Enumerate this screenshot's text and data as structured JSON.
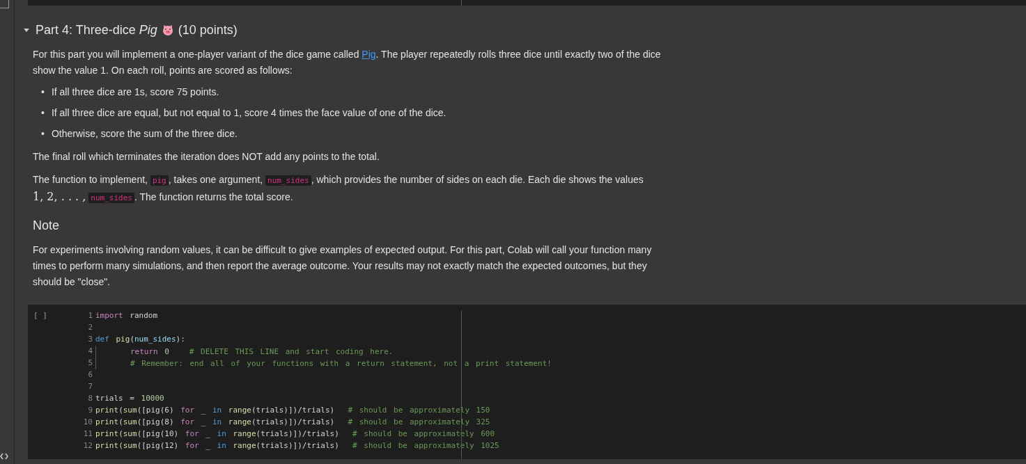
{
  "section": {
    "expanded": true,
    "title": "Part 4: Three-dice *Pig*",
    "points": "(10 points)"
  },
  "intro": [
    {
      "kind": "text",
      "text": "For this part you will implement a one-player variant of the dice game called "
    },
    {
      "kind": "link",
      "text": "Pig"
    },
    {
      "kind": "text",
      "text": ". The player repeatedly rolls three dice until exactly two of the dice show the value 1. On each roll, points are scored as follows:"
    }
  ],
  "rules": [
    {
      "marker": "•",
      "text": "If all three dice are 1s, score 75 points."
    },
    {
      "marker": "•",
      "text": "If all three dice are equal, but not equal to 1, score 4 times the face value of one of the dice."
    },
    {
      "marker": "•",
      "text": "Otherwise, score the sum of the three dice."
    }
  ],
  "final_note": "The final roll which terminates the iteration does NOT add any points to the total.",
  "function_desc": [
    {
      "kind": "text",
      "text": "The function to implement, "
    },
    {
      "kind": "code",
      "text": "pig"
    },
    {
      "kind": "text",
      "text": ", takes one argument, "
    },
    {
      "kind": "code",
      "text": "num_sides"
    },
    {
      "kind": "text",
      "text": ", which provides the number of sides on each die. Each die shows the values "
    },
    {
      "kind": "math",
      "text": "1, 2, . . . ,"
    },
    {
      "kind": "code",
      "text": "num_sides"
    },
    {
      "kind": "text",
      "text": ". The function returns the total score."
    }
  ],
  "note_heading": "Note",
  "note": "For experiments involving random values, it can be difficult to give examples of expected output. For this part, Colab will call your function many times to perform many simulations, and then report the average outcome. Your results may not exactly match the expected outcomes, but they should be \"close\".",
  "code_cell": {
    "run_marker": "[ ]",
    "lines": [
      {
        "number": "1",
        "tokens": [
          {
            "kind": "keyword",
            "text": "import"
          },
          {
            "kind": "plain",
            "text": " random"
          }
        ]
      },
      {
        "number": "2"
      },
      {
        "number": "3",
        "tokens": [
          {
            "kind": "def",
            "text": "def"
          },
          {
            "kind": "func",
            "text": " pig"
          },
          {
            "kind": "plain",
            "text": "("
          },
          {
            "kind": "param",
            "text": "num_sides"
          },
          {
            "kind": "plain",
            "text": "):"
          }
        ]
      },
      {
        "number": "4",
        "tokens": [
          {
            "kind": "indent"
          },
          {
            "kind": "keyword",
            "text": "return"
          },
          {
            "kind": "number",
            "text": " 0"
          },
          {
            "kind": "comment",
            "text": "   # DELETE THIS LINE and start coding here."
          }
        ]
      },
      {
        "number": "5",
        "tokens": [
          {
            "kind": "indent"
          },
          {
            "kind": "comment",
            "text": "# Remember: end all of your functions with a return statement, not a print statement!"
          }
        ]
      },
      {
        "number": "6"
      },
      {
        "number": "7"
      },
      {
        "number": "8",
        "tokens": [
          {
            "kind": "plain",
            "text": "trials = "
          },
          {
            "kind": "number",
            "text": "10000"
          }
        ]
      },
      {
        "number": "9",
        "tokens": [
          {
            "kind": "func",
            "text": "print"
          },
          {
            "kind": "plain",
            "text": "("
          },
          {
            "kind": "func",
            "text": "sum"
          },
          {
            "kind": "plain",
            "text": "([pig(6) "
          },
          {
            "kind": "keyword",
            "text": "for"
          },
          {
            "kind": "plain",
            "text": " _ "
          },
          {
            "kind": "def",
            "text": "in"
          },
          {
            "kind": "func",
            "text": " range"
          },
          {
            "kind": "plain",
            "text": "(trials)])/trials)  "
          },
          {
            "kind": "comment",
            "text": "# should be approximately 150"
          }
        ]
      },
      {
        "number": "10",
        "tokens": [
          {
            "kind": "func",
            "text": "print"
          },
          {
            "kind": "plain",
            "text": "("
          },
          {
            "kind": "func",
            "text": "sum"
          },
          {
            "kind": "plain",
            "text": "([pig(8) "
          },
          {
            "kind": "keyword",
            "text": "for"
          },
          {
            "kind": "plain",
            "text": " _ "
          },
          {
            "kind": "def",
            "text": "in"
          },
          {
            "kind": "func",
            "text": " range"
          },
          {
            "kind": "plain",
            "text": "(trials)])/trials)  "
          },
          {
            "kind": "comment",
            "text": "# should be approximately 325"
          }
        ]
      },
      {
        "number": "11",
        "tokens": [
          {
            "kind": "func",
            "text": "print"
          },
          {
            "kind": "plain",
            "text": "("
          },
          {
            "kind": "func",
            "text": "sum"
          },
          {
            "kind": "plain",
            "text": "([pig(10) "
          },
          {
            "kind": "keyword",
            "text": "for"
          },
          {
            "kind": "plain",
            "text": " _ "
          },
          {
            "kind": "def",
            "text": "in"
          },
          {
            "kind": "func",
            "text": " range"
          },
          {
            "kind": "plain",
            "text": "(trials)])/trials)  "
          },
          {
            "kind": "comment",
            "text": "# should be approximately 600"
          }
        ]
      },
      {
        "number": "12",
        "tokens": [
          {
            "kind": "func",
            "text": "print"
          },
          {
            "kind": "plain",
            "text": "("
          },
          {
            "kind": "func",
            "text": "sum"
          },
          {
            "kind": "plain",
            "text": "([pig(12) "
          },
          {
            "kind": "keyword",
            "text": "for"
          },
          {
            "kind": "plain",
            "text": " _ "
          },
          {
            "kind": "def",
            "text": "in"
          },
          {
            "kind": "func",
            "text": " range"
          },
          {
            "kind": "plain",
            "text": "(trials)])/trials)  "
          },
          {
            "kind": "comment",
            "text": "# should be approximately 1025"
          }
        ]
      }
    ]
  }
}
